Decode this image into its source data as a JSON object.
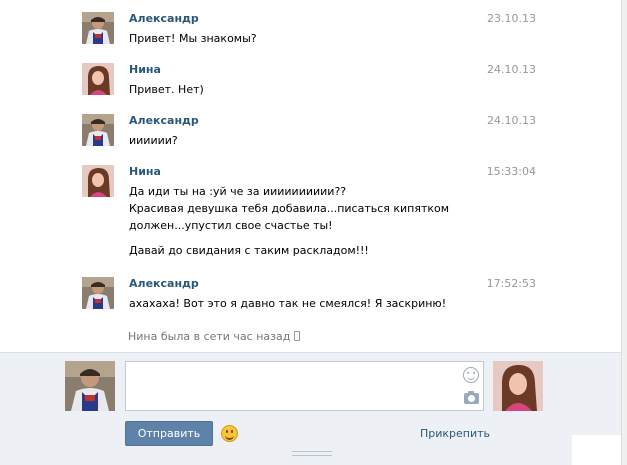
{
  "messages": [
    {
      "author": "Александр",
      "date": "23.10.13",
      "avatar": "alexander",
      "lines": [
        "Привет! Мы знакомы?"
      ]
    },
    {
      "author": "Нина",
      "date": "24.10.13",
      "avatar": "nina",
      "lines": [
        "Привет. Нет)"
      ]
    },
    {
      "author": "Александр",
      "date": "24.10.13",
      "avatar": "alexander",
      "lines": [
        "ииииии?"
      ]
    },
    {
      "author": "Нина",
      "date": "15:33:04",
      "avatar": "nina",
      "lines": [
        "Да иди ты на :уй че за ииииииииии??",
        "Красивая девушка тебя добавила...писаться кипятком",
        "должен...упустил свое счастье ты!",
        "",
        "Давай до свидания с таким раскладом!!!"
      ]
    },
    {
      "author": "Александр",
      "date": "17:52:53",
      "avatar": "alexander",
      "lines": [
        "ахахаха! Вот это я давно так не смеялся! Я заскриню!"
      ]
    }
  ],
  "status": {
    "text": "Нина была в сети час назад",
    "icon": "mobile-phone-icon"
  },
  "compose": {
    "input_value": "",
    "send_label": "Отправить",
    "attach_label": "Прикрепить",
    "emoji_icon": "smiley-icon",
    "input_icons": [
      "smile-icon",
      "camera-icon"
    ]
  },
  "colors": {
    "accent": "#2b587a",
    "button": "#5e82a8",
    "panel": "#edf1f5",
    "date": "#999999"
  }
}
